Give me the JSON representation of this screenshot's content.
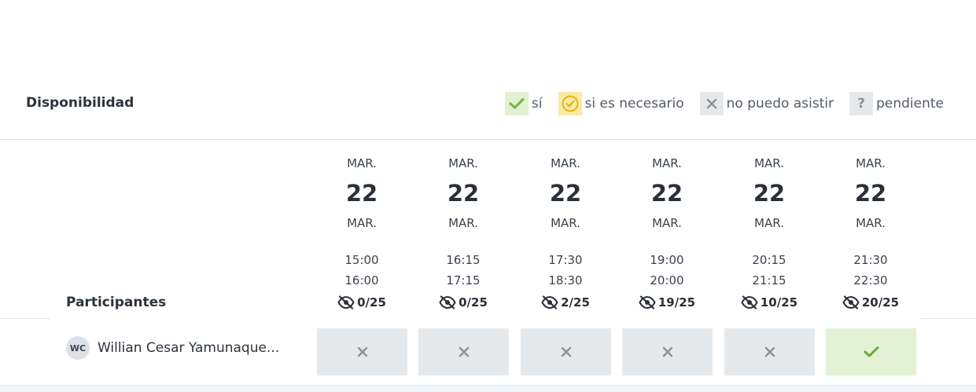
{
  "availability": {
    "title": "Disponibilidad",
    "legend": [
      {
        "icon": "check-icon",
        "label": "sí",
        "color": "#7ab648"
      },
      {
        "icon": "check-circle-icon",
        "label": "si es necesario",
        "color": "#e0b317"
      },
      {
        "icon": "close-icon",
        "label": "no puedo asistir",
        "color": "#8a9099"
      },
      {
        "icon": "question-icon",
        "symbol": "?",
        "label": "pendiente",
        "color": "#8a9099"
      }
    ]
  },
  "participants_label": "Participantes",
  "columns": [
    {
      "dow": "MAR.",
      "day": "22",
      "month": "MAR.",
      "start": "15:00",
      "end": "16:00",
      "count": "0/25"
    },
    {
      "dow": "MAR.",
      "day": "22",
      "month": "MAR.",
      "start": "16:15",
      "end": "17:15",
      "count": "0/25"
    },
    {
      "dow": "MAR.",
      "day": "22",
      "month": "MAR.",
      "start": "17:30",
      "end": "18:30",
      "count": "2/25"
    },
    {
      "dow": "MAR.",
      "day": "22",
      "month": "MAR.",
      "start": "19:00",
      "end": "20:00",
      "count": "19/25"
    },
    {
      "dow": "MAR.",
      "day": "22",
      "month": "MAR.",
      "start": "20:15",
      "end": "21:15",
      "count": "10/25"
    },
    {
      "dow": "MAR.",
      "day": "22",
      "month": "MAR.",
      "start": "21:30",
      "end": "22:30",
      "count": "20/25"
    }
  ],
  "participant": {
    "initials": "WC",
    "name": "Willian Cesar Yamunaque...",
    "responses": [
      "no",
      "no",
      "no",
      "no",
      "no",
      "yes"
    ]
  }
}
